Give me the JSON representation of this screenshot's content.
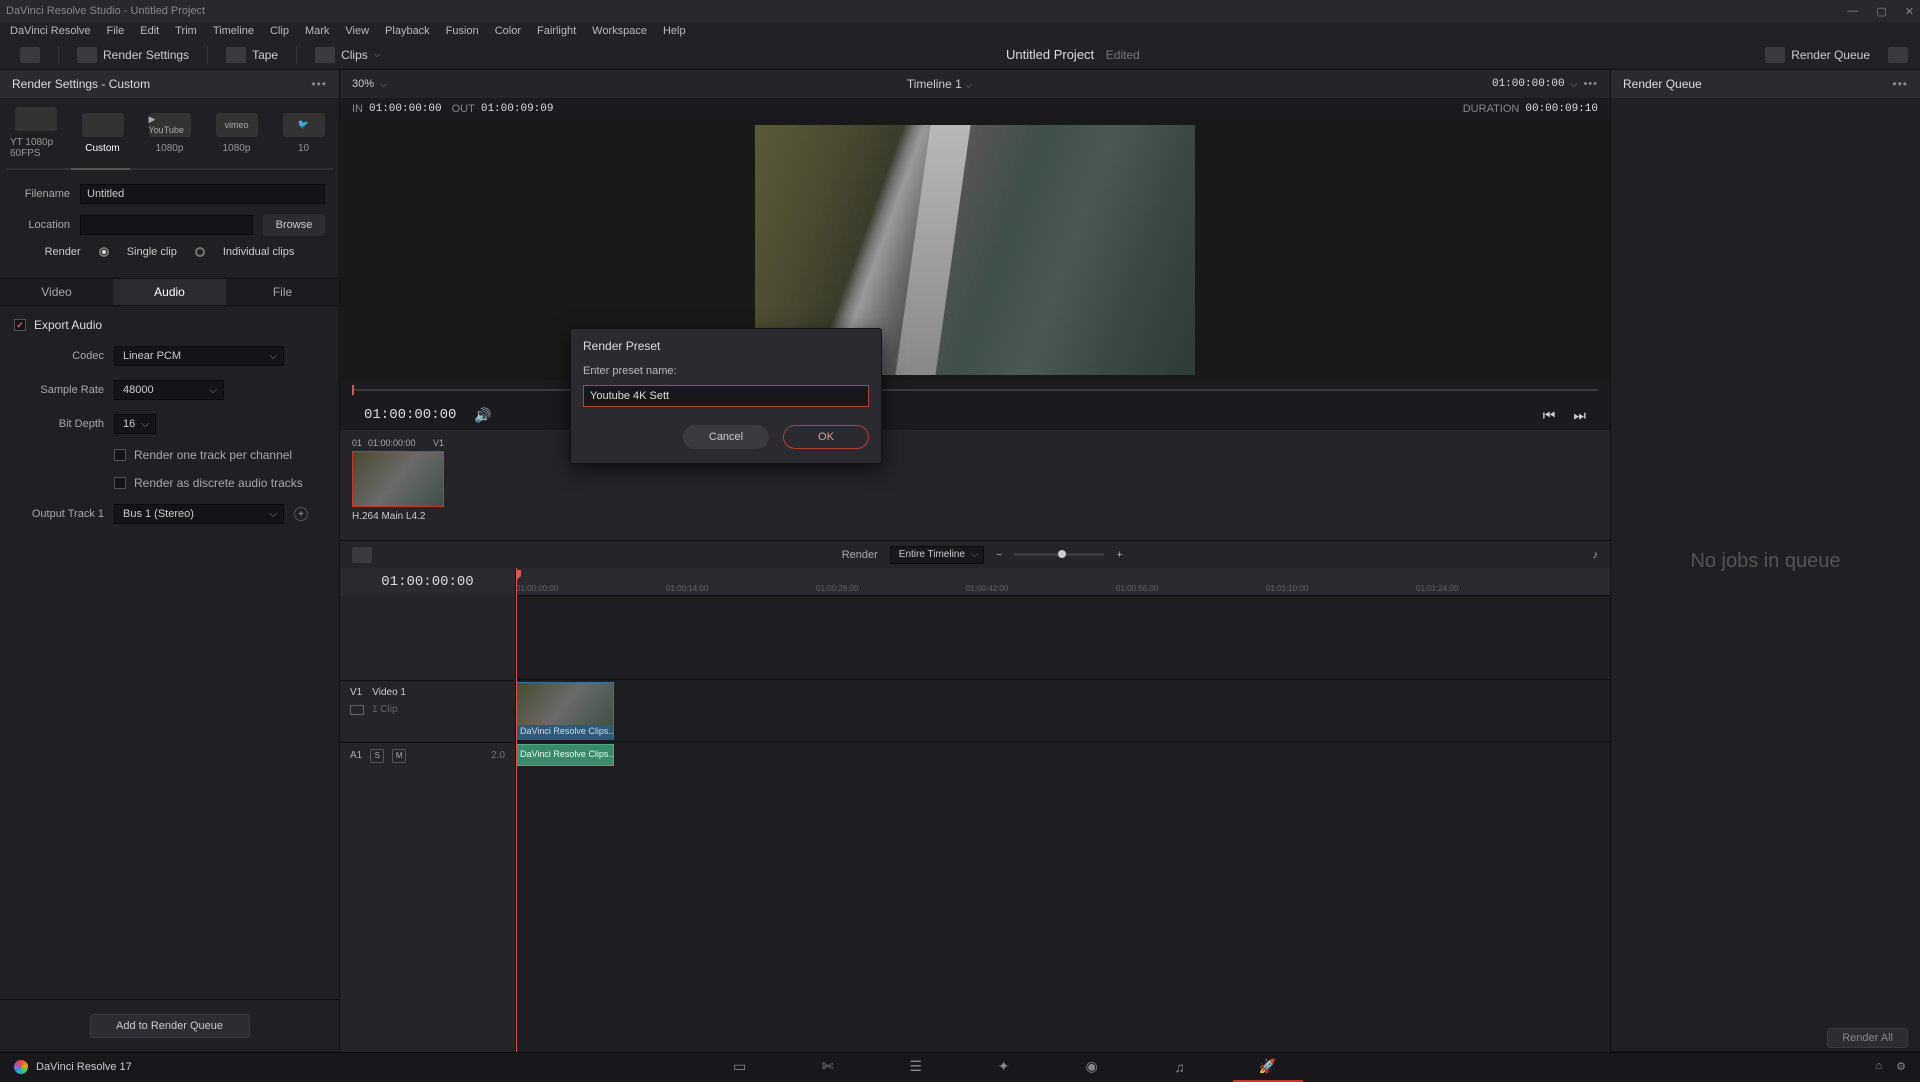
{
  "titlebar": {
    "text": "DaVinci Resolve Studio - Untitled Project"
  },
  "menus": [
    "DaVinci Resolve",
    "File",
    "Edit",
    "Trim",
    "Timeline",
    "Clip",
    "Mark",
    "View",
    "Playback",
    "Fusion",
    "Color",
    "Fairlight",
    "Workspace",
    "Help"
  ],
  "toolbar": {
    "render_settings": "Render Settings",
    "tape": "Tape",
    "clips": "Clips",
    "project": "Untitled Project",
    "edited": "Edited",
    "render_queue_btn": "Render Queue"
  },
  "left": {
    "title": "Render Settings - Custom",
    "presets": [
      {
        "label": "YT 1080p 60FPS",
        "icon": ""
      },
      {
        "label": "Custom",
        "icon": ""
      },
      {
        "label": "1080p",
        "icon": "▶ YouTube"
      },
      {
        "label": "1080p",
        "icon": "vimeo"
      },
      {
        "label": "10",
        "icon": ""
      }
    ],
    "filename_label": "Filename",
    "filename": "Untitled",
    "location_label": "Location",
    "location": "",
    "browse": "Browse",
    "render_label": "Render",
    "single_clip": "Single clip",
    "individual_clips": "Individual clips",
    "tabs": {
      "video": "Video",
      "audio": "Audio",
      "file": "File"
    },
    "export_audio": "Export Audio",
    "codec_label": "Codec",
    "codec": "Linear PCM",
    "samplerate_label": "Sample Rate",
    "samplerate": "48000",
    "bitdepth_label": "Bit Depth",
    "bitdepth": "16",
    "render_one_track": "Render one track per channel",
    "render_discrete": "Render as discrete audio tracks",
    "output_track_label": "Output Track 1",
    "output_track": "Bus 1 (Stereo)",
    "add_to_queue": "Add to Render Queue"
  },
  "viewer": {
    "zoom": "30%",
    "timeline_name": "Timeline 1",
    "tc_right": "01:00:00:00",
    "in_lbl": "IN",
    "in_tc": "01:00:00:00",
    "out_lbl": "OUT",
    "out_tc": "01:00:09:09",
    "dur_lbl": "DURATION",
    "dur_tc": "00:00:09:10",
    "transport_tc": "01:00:00:00"
  },
  "bin": {
    "clip_idx": "01",
    "clip_tc": "01:00:00:00",
    "clip_track": "V1",
    "clip_name": "H.264 Main L4.2"
  },
  "tlbar": {
    "render_lbl": "Render",
    "range": "Entire Timeline"
  },
  "timeline": {
    "tc": "01:00:00:00",
    "ticks": [
      "01:00:00:00",
      "01:00:14:00",
      "01:00:28:00",
      "01:00:42:00",
      "01:00:56:00",
      "01:01:10:00",
      "01:01:24:00"
    ],
    "v1": "V1",
    "video1": "Video 1",
    "clipcount": "1 Clip",
    "a1": "A1",
    "a1_num": "2.0",
    "vclip_label": "DaVinci Resolve Clips...",
    "aclip_label": "DaVinci Resolve Clips..."
  },
  "right": {
    "title": "Render Queue",
    "render_all": "Render All",
    "empty": "No jobs in queue"
  },
  "bottombar": {
    "brand": "DaVinci Resolve 17"
  },
  "modal": {
    "title": "Render Preset",
    "label": "Enter preset name:",
    "value": "Youtube 4K Sett",
    "cancel": "Cancel",
    "ok": "OK"
  }
}
